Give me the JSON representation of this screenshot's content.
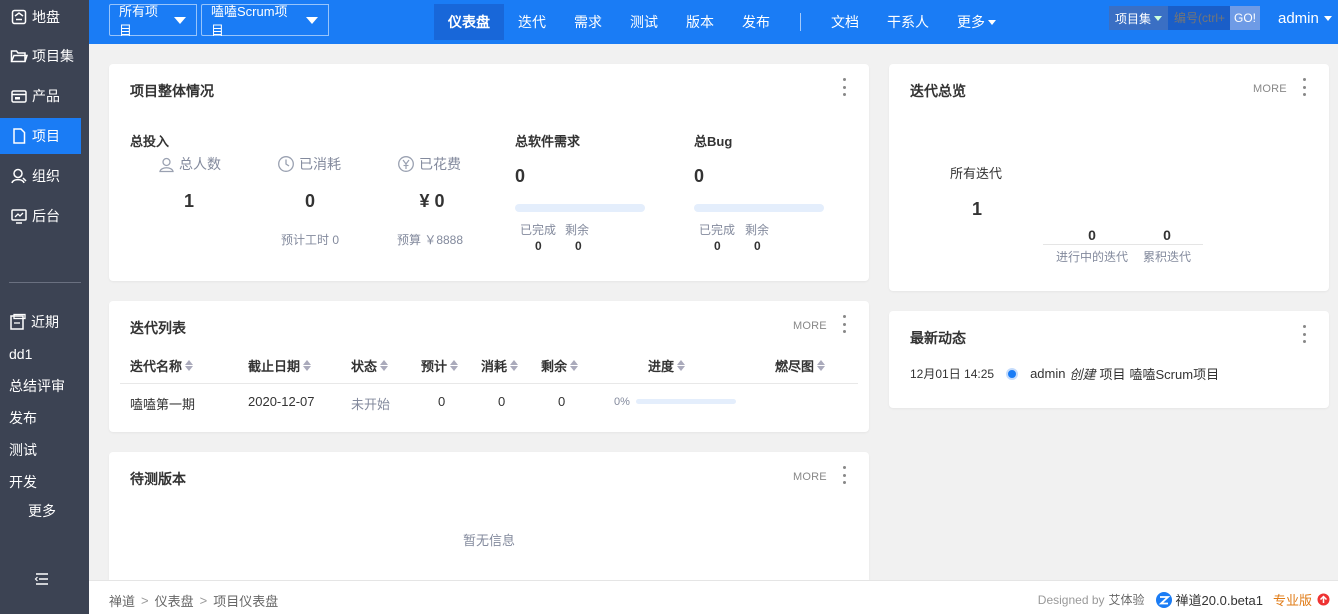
{
  "sidebar": {
    "items": [
      {
        "label": "地盘",
        "icon": "home-icon"
      },
      {
        "label": "项目集",
        "icon": "folder-open-icon"
      },
      {
        "label": "产品",
        "icon": "product-icon"
      },
      {
        "label": "项目",
        "icon": "file-icon"
      },
      {
        "label": "组织",
        "icon": "user-icon"
      },
      {
        "label": "后台",
        "icon": "monitor-icon"
      }
    ],
    "recent_label": "近期",
    "recent_items": [
      "dd1",
      "总结评审",
      "发布",
      "测试",
      "开发"
    ],
    "more_label": "更多"
  },
  "header": {
    "crumb_all": "所有项目",
    "crumb_project": "嗑嗑Scrum项目",
    "nav": [
      "仪表盘",
      "迭代",
      "需求",
      "测试",
      "版本",
      "发布"
    ],
    "nav2": [
      "文档",
      "干系人"
    ],
    "nav_more": "更多",
    "search_type": "项目集",
    "search_placeholder": "编号(ctrl+",
    "go": "GO!",
    "user": "admin"
  },
  "overview": {
    "title": "项目整体情况",
    "invest_title": "总投入",
    "people_label": "总人数",
    "people_val": "1",
    "consumed_label": "已消耗",
    "consumed_val": "0",
    "consumed_note": "预计工时 0",
    "spent_label": "已花费",
    "spent_val": "¥ 0",
    "spent_note": "预算 ￥8888",
    "story_title": "总软件需求",
    "story_val": "0",
    "story_done_label": "已完成",
    "story_left_label": "剩余",
    "story_done": "0",
    "story_left": "0",
    "bug_title": "总Bug",
    "bug_val": "0",
    "bug_done_label": "已完成",
    "bug_left_label": "剩余",
    "bug_done": "0",
    "bug_left": "0"
  },
  "iterations_overview": {
    "title": "迭代总览",
    "more": "MORE",
    "all_label": "所有迭代",
    "all_val": "1",
    "active_val": "0",
    "active_label": "进行中的迭代",
    "total_val": "0",
    "total_label": "累积迭代"
  },
  "iteration_list": {
    "title": "迭代列表",
    "more": "MORE",
    "columns": [
      "迭代名称",
      "截止日期",
      "状态",
      "预计",
      "消耗",
      "剩余",
      "进度",
      "燃尽图"
    ],
    "rows": [
      {
        "name": "嗑嗑第一期",
        "end": "2020-12-07",
        "status": "未开始",
        "estimate": "0",
        "consumed": "0",
        "left": "0",
        "progress": "0%",
        "progress_value": 0
      }
    ]
  },
  "pending_builds": {
    "title": "待测版本",
    "more": "MORE",
    "empty": "暂无信息"
  },
  "dynamics": {
    "title": "最新动态",
    "items": [
      {
        "time": "12月01日 14:25",
        "user": "admin",
        "action": "创建",
        "object_type": "项目",
        "object": "嗑嗑Scrum项目"
      }
    ]
  },
  "footer": {
    "breadcrumb": [
      "禅道",
      "仪表盘",
      "项目仪表盘"
    ],
    "designed_by": "Designed by",
    "designer": "艾体验",
    "version": "禅道20.0.beta1",
    "edition": "专业版"
  },
  "colors": {
    "primary": "#1a7cf5",
    "sidebar": "#3c4353",
    "edition": "#e07b16"
  }
}
